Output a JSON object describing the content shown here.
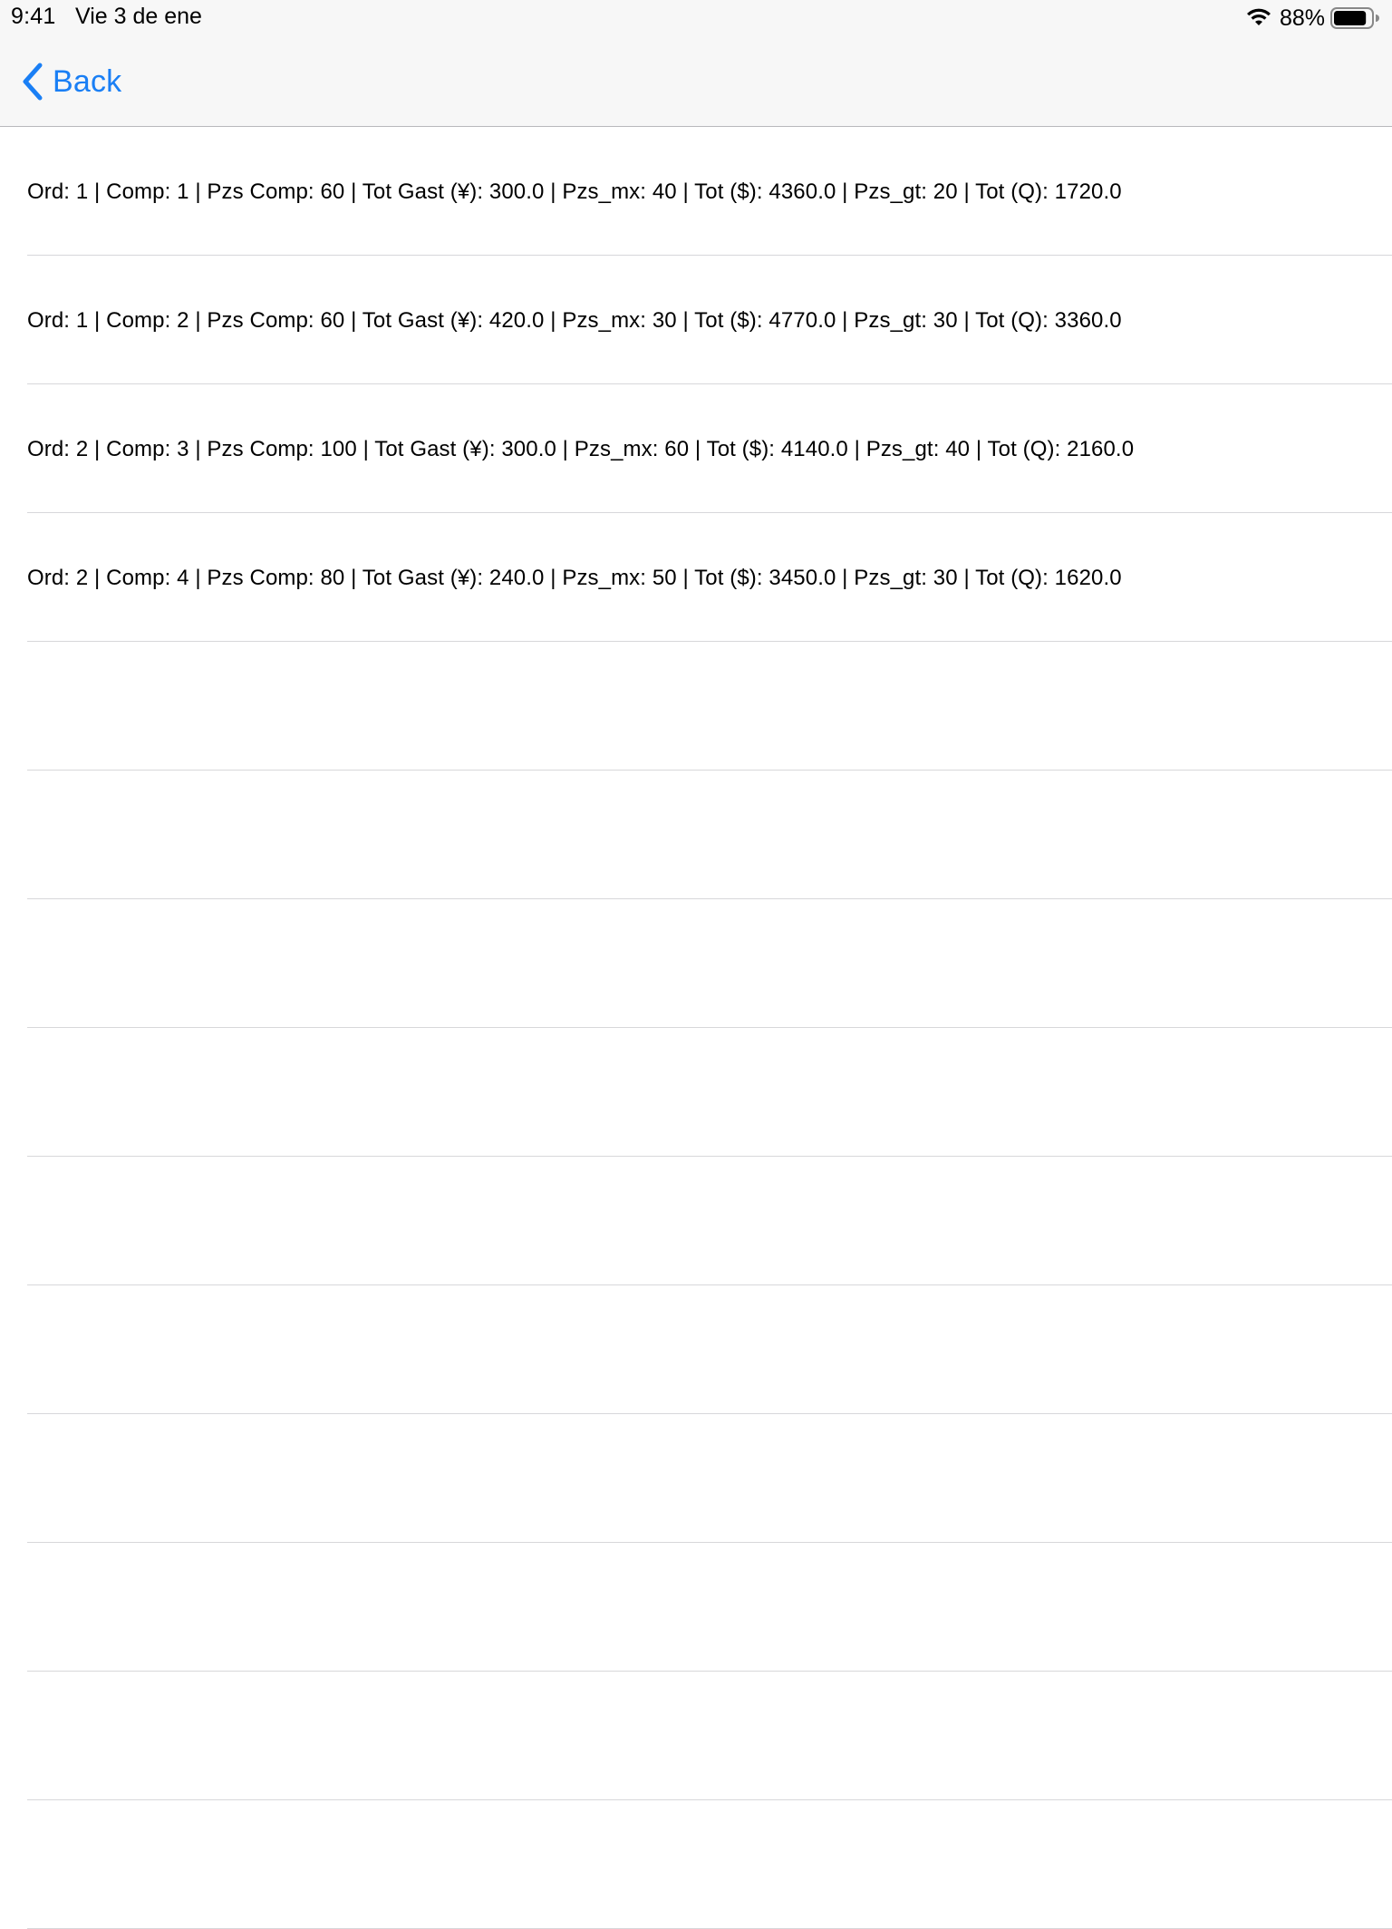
{
  "status_bar": {
    "time": "9:41",
    "date": "Vie 3 de ene",
    "battery_percent": "88%",
    "battery_level": 0.88,
    "wifi_icon": "wifi-icon",
    "battery_icon": "battery-icon"
  },
  "nav": {
    "back_label": "Back",
    "back_icon": "chevron-left-icon",
    "accent_color": "#1a7ff5"
  },
  "rows": [
    {
      "text": "Ord: 1 | Comp: 1 | Pzs Comp: 60 | Tot Gast (¥): 300.0 | Pzs_mx: 40 | Tot ($): 4360.0 | Pzs_gt: 20 | Tot (Q): 1720.0"
    },
    {
      "text": "Ord: 1 | Comp: 2 | Pzs Comp: 60 | Tot Gast (¥): 420.0 | Pzs_mx: 30 | Tot ($): 4770.0 | Pzs_gt: 30 | Tot (Q): 3360.0"
    },
    {
      "text": "Ord: 2 | Comp: 3 | Pzs Comp: 100 | Tot Gast (¥): 300.0 | Pzs_mx: 60 | Tot ($): 4140.0 | Pzs_gt: 40 | Tot (Q): 2160.0"
    },
    {
      "text": "Ord: 2 | Comp: 4 | Pzs Comp: 80 | Tot Gast (¥): 240.0 | Pzs_mx: 50 | Tot ($): 3450.0 | Pzs_gt: 30 | Tot (Q): 1620.0"
    },
    {
      "text": ""
    },
    {
      "text": ""
    },
    {
      "text": ""
    },
    {
      "text": ""
    },
    {
      "text": ""
    },
    {
      "text": ""
    },
    {
      "text": ""
    },
    {
      "text": ""
    },
    {
      "text": ""
    },
    {
      "text": ""
    }
  ]
}
